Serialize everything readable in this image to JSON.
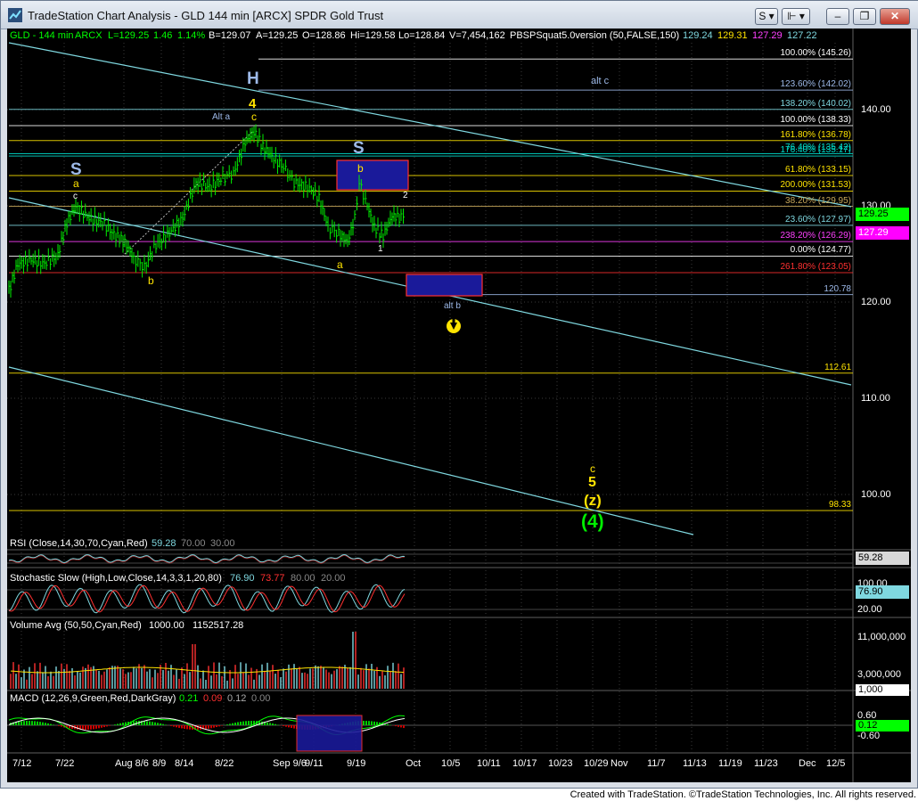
{
  "window": {
    "title": "TradeStation Chart Analysis - GLD 144 min [ARCX] SPDR Gold Trust",
    "buttons": {
      "s_menu": "S ▾",
      "f_menu": "⊩ ▾",
      "minimize": "–",
      "restore": "❐",
      "close": "✕"
    }
  },
  "colors": {
    "background": "#000000",
    "price": "#00ff00",
    "channel": "#7fd8e0",
    "annotation_yellow": "#ffe400",
    "annotation_blue": "#9db9e8",
    "fib_gold": "#c8a85a",
    "fib_red": "#ff3030",
    "fib_magenta": "#ff40ff",
    "wave_green": "#00ee00"
  },
  "header": {
    "symbol": "GLD - 144 min",
    "exchange": "ARCX",
    "last": "L=129.25",
    "change": "1.46",
    "pct": "1.14%",
    "bid": "B=129.07",
    "ask": "A=129.25",
    "open": "O=128.86",
    "high": "Hi=129.58",
    "low": "Lo=128.84",
    "volume": "V=7,454,162",
    "indicator": "PBSPSquat5.0version (50,FALSE,150)",
    "ind_vals": [
      "129.24",
      "129.31",
      "127.29",
      "127.22"
    ]
  },
  "price_axis": [
    "140.00",
    "130.00",
    "120.00",
    "110.00",
    "100.00"
  ],
  "price_tags": [
    {
      "value": "129.25",
      "bg": "#00ff00",
      "fg": "#000000"
    },
    {
      "value": "127.29",
      "bg": "#ff00ff",
      "fg": "#ffffff"
    }
  ],
  "levels": [
    {
      "label": "100.00% (145.26)",
      "color": "#ffffff",
      "price": 145.26
    },
    {
      "label": "123.60% (142.02)",
      "color": "#9db9e8",
      "price": 142.02
    },
    {
      "label": "138.20% (140.02)",
      "color": "#7fd8e0",
      "price": 140.02
    },
    {
      "label": "100.00% (138.33)",
      "color": "#ffffff",
      "price": 138.33
    },
    {
      "label": "161.80% (136.78)",
      "color": "#ffe400",
      "price": 136.78
    },
    {
      "label": "76.40% (135.42)",
      "color": "#00ddcc",
      "price": 135.42
    },
    {
      "label": "176.40% (135.17)",
      "color": "#00ddcc",
      "price": 135.17
    },
    {
      "label": "61.80% (133.15)",
      "color": "#ffe400",
      "price": 133.15
    },
    {
      "label": "200.00% (131.53)",
      "color": "#ffe400",
      "price": 131.53
    },
    {
      "label": "38.20% (129.95)",
      "color": "#c8a85a",
      "price": 129.95
    },
    {
      "label": "23.60% (127.97)",
      "color": "#7fd8e0",
      "price": 127.97
    },
    {
      "label": "238.20% (126.29)",
      "color": "#ff40ff",
      "price": 126.29
    },
    {
      "label": "0.00% (124.77)",
      "color": "#ffffff",
      "price": 124.77
    },
    {
      "label": "261.80% (123.05)",
      "color": "#ff3030",
      "price": 123.05
    },
    {
      "label": "120.78",
      "color": "#9db9e8",
      "price": 120.78
    },
    {
      "label": "112.61",
      "color": "#ffe400",
      "price": 112.61
    },
    {
      "label": "98.33",
      "color": "#ffe400",
      "price": 98.33
    }
  ],
  "annotations": {
    "H": "H",
    "wave4": "4",
    "c_top": "c",
    "alt_a": "Alt a",
    "S_left": "S",
    "a_left": "a",
    "c_left": "c",
    "b_low": "b",
    "S_right": "S",
    "b_right": "b",
    "a_mid": "a",
    "one": "1",
    "two": "2",
    "alt_b": "alt b",
    "alt_c": "alt c",
    "c_target": "c",
    "five": "5",
    "z": "(z)",
    "four": "(4)"
  },
  "x_axis": [
    "7/12",
    "7/22",
    "Aug 8/6",
    "8/9",
    "8/14",
    "8/22",
    "Sep 9/6",
    "9/11",
    "9/19",
    "Oct",
    "10/5",
    "10/11",
    "10/17",
    "10/23",
    "10/29",
    "Nov",
    "11/7",
    "11/13",
    "11/19",
    "11/23",
    "Dec",
    "12/5"
  ],
  "rsi": {
    "label": "RSI (Close,14,30,70,Cyan,Red)",
    "value": "59.28",
    "ob": "70.00",
    "os": "30.00",
    "tag": "59.28"
  },
  "stoch": {
    "label": "Stochastic Slow (High,Low,Close,14,3,3,1,20,80)",
    "k": "76.90",
    "d": "73.77",
    "ob": "80.00",
    "os": "20.00",
    "axis": [
      "100.00",
      "20.00"
    ],
    "tag": "76.90"
  },
  "volume": {
    "label": "Volume Avg (50,50,Cyan,Red)",
    "v1": "1000.00",
    "v2": "1152517.28",
    "axis": [
      "11,000,000",
      "3,000,000"
    ],
    "tag": "1,000"
  },
  "macd": {
    "label": "MACD (12,26,9,Green,Red,DarkGray)",
    "m": "0.21",
    "s": "0.09",
    "h": "0.12",
    "z": "0.00",
    "axis": [
      "0.60",
      "-0.60"
    ],
    "tag": "0.12"
  },
  "footer": "Created with TradeStation. ©TradeStation Technologies, Inc. All rights reserved."
}
